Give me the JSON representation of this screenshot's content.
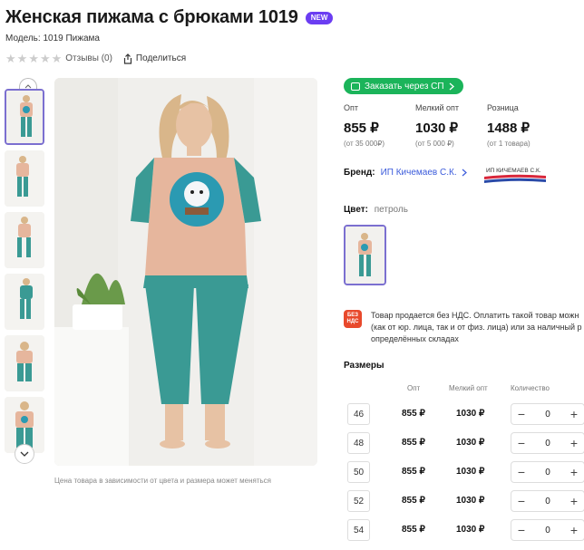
{
  "product": {
    "title": "Женская пижама с брюками 1019",
    "badge": "NEW",
    "model": "Модель: 1019 Пижама",
    "reviews": "Отзывы (0)",
    "share": "Поделиться",
    "rating": 0,
    "rating_max": 5
  },
  "gallery": {
    "caption": "Цена товара в зависимости от цвета и размера может меняться",
    "thumbnail_count": 6,
    "active_index": 0
  },
  "order_button": "Заказать через СП",
  "prices": [
    {
      "label": "Опт",
      "value": "855 ₽",
      "note": "(от 35 000₽)"
    },
    {
      "label": "Мелкий опт",
      "value": "1030 ₽",
      "note": "(от 5 000 ₽)"
    },
    {
      "label": "Розница",
      "value": "1488 ₽",
      "note": "(от 1 товара)"
    }
  ],
  "brand": {
    "label": "Бренд:",
    "name": "ИП Кичемаев С.К.",
    "logo_text": "ИП КИЧЕМАЕВ С.К."
  },
  "color": {
    "label": "Цвет:",
    "value": "петроль"
  },
  "nds": {
    "badge_line1": "БЕЗ",
    "badge_line2": "НДС",
    "text": "Товар продается без НДС. Оплатить такой товар можн\n(как от юр. лица, так и от физ. лица) или за наличный р\nопределённых складах"
  },
  "sizes": {
    "title": "Размеры",
    "headers": {
      "opt": "Опт",
      "small": "Мелкий опт",
      "qty": "Количество"
    },
    "rows": [
      {
        "size": "46",
        "opt": "855 ₽",
        "small": "1030 ₽",
        "qty": "0"
      },
      {
        "size": "48",
        "opt": "855 ₽",
        "small": "1030 ₽",
        "qty": "0"
      },
      {
        "size": "50",
        "opt": "855 ₽",
        "small": "1030 ₽",
        "qty": "0"
      },
      {
        "size": "52",
        "opt": "855 ₽",
        "small": "1030 ₽",
        "qty": "0"
      },
      {
        "size": "54",
        "opt": "855 ₽",
        "small": "1030 ₽",
        "qty": "0"
      }
    ]
  },
  "colors": {
    "accent": "#6b3df2",
    "green": "#1bb45a",
    "link": "#3b5bdb",
    "teal": "#3a9a94",
    "peach": "#e6b69d",
    "nds_red": "#e8492c"
  },
  "icons": [
    "star-icon",
    "share-icon",
    "chevron-up-icon",
    "chevron-down-icon",
    "cart-icon",
    "chevron-right-icon",
    "minus-icon",
    "plus-icon"
  ]
}
